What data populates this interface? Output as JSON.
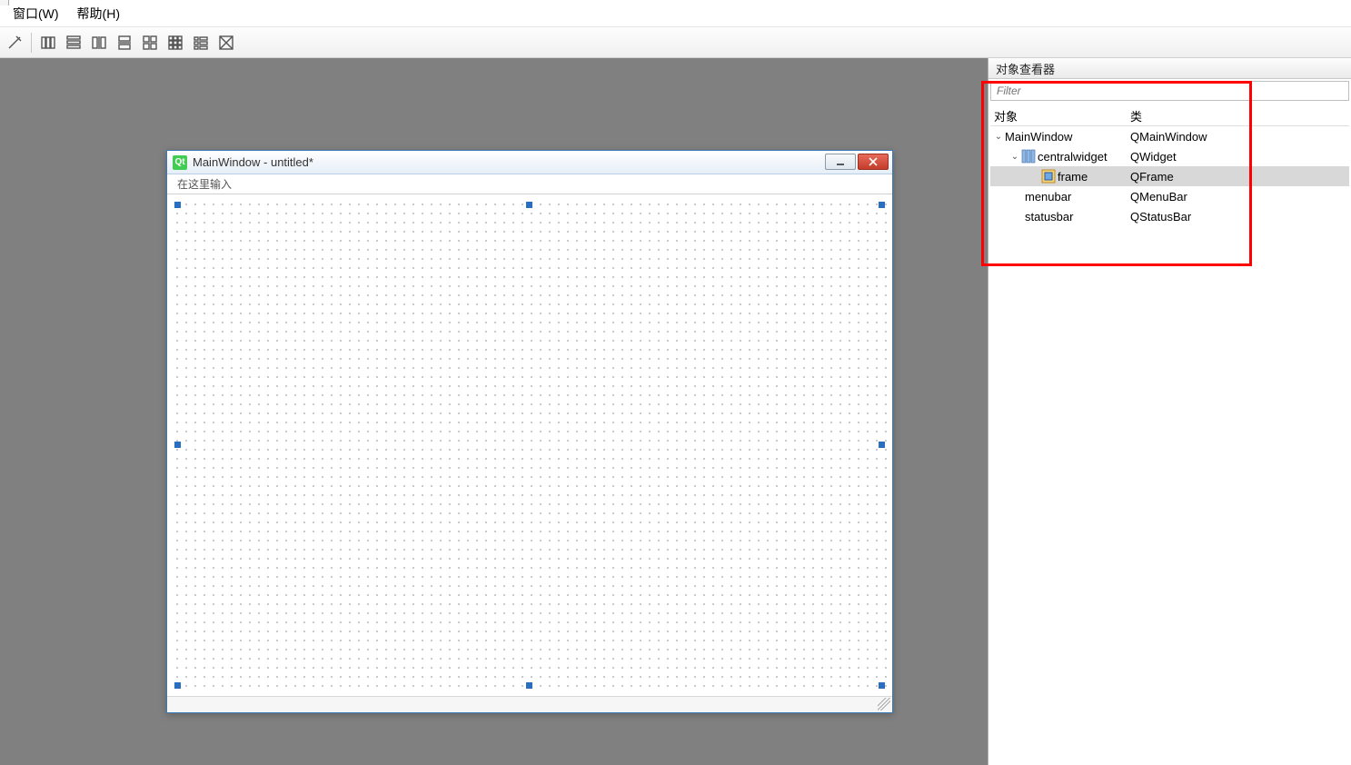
{
  "menubar": {
    "items": [
      {
        "label": "窗口(W)"
      },
      {
        "label": "帮助(H)"
      }
    ]
  },
  "toolbar": {
    "buttons": [
      "edit-icon",
      "layout-horizontal-icon",
      "layout-lines-icon",
      "layout-hsplit-icon",
      "layout-vsplit-icon",
      "layout-grid-icon",
      "layout-grid-small-icon",
      "layout-form-icon",
      "break-layout-icon"
    ]
  },
  "designer_window": {
    "title": "MainWindow - untitled*",
    "menubar_placeholder": "在这里输入"
  },
  "inspector": {
    "title": "对象查看器",
    "filter_placeholder": "Filter",
    "headers": {
      "object": "对象",
      "class": "类"
    },
    "rows": [
      {
        "indent": 0,
        "expand": true,
        "icon": "none",
        "name": "MainWindow",
        "class": "QMainWindow",
        "selected": false
      },
      {
        "indent": 1,
        "expand": true,
        "icon": "layout",
        "name": "centralwidget",
        "class": "QWidget",
        "selected": false
      },
      {
        "indent": 2,
        "expand": null,
        "icon": "frame",
        "name": "frame",
        "class": "QFrame",
        "selected": true
      },
      {
        "indent": 1,
        "expand": null,
        "icon": "none",
        "name": "menubar",
        "class": "QMenuBar",
        "selected": false
      },
      {
        "indent": 1,
        "expand": null,
        "icon": "none",
        "name": "statusbar",
        "class": "QStatusBar",
        "selected": false
      }
    ]
  }
}
